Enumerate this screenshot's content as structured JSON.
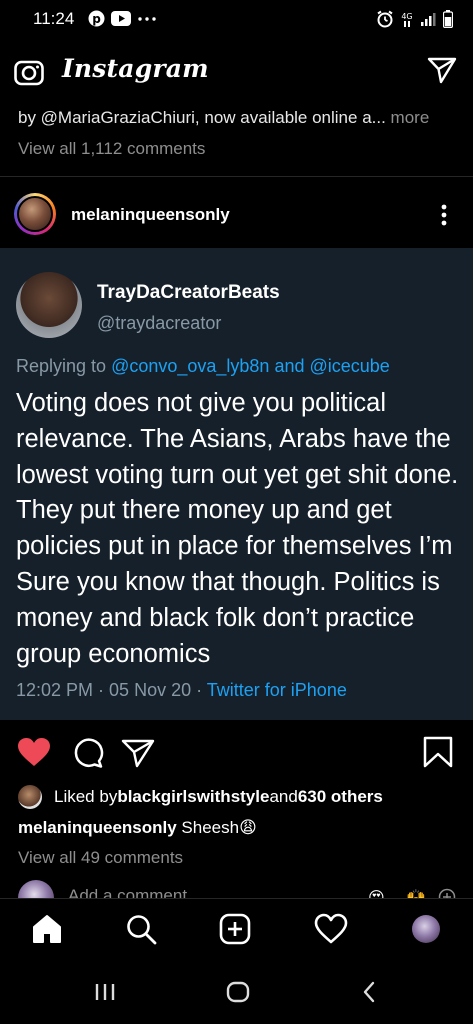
{
  "status_bar": {
    "time": "11:24",
    "left_icons": [
      "pinterest-icon",
      "youtube-icon",
      "more-dots-icon"
    ],
    "right_icons": [
      "alarm-icon",
      "data-icon",
      "signal-icon",
      "battery-icon"
    ]
  },
  "header": {
    "logo": "Instagram",
    "camera_icon": "camera-icon",
    "direct_icon": "direct-message-icon"
  },
  "prev_post": {
    "caption": "by @MariaGraziaChiuri, now available online a...",
    "more": " more",
    "view_comments": "View all 1,112 comments"
  },
  "post": {
    "username": "melaninqueensonly",
    "tweet": {
      "name": "TrayDaCreatorBeats",
      "handle": "@traydacreator",
      "reply_prefix": "Replying to ",
      "reply_to": "@convo_ova_lyb8n and @icecube",
      "text": "Voting does not give you political relevance. The Asians,  Arabs have the lowest voting turn out yet get shit done. They put there money up and get policies put in place for themselves I’m Sure you know that though. Politics is money and black folk don’t practice group economics",
      "timestamp": "12:02 PM · 05 Nov 20 · ",
      "source": "Twitter for iPhone"
    },
    "liked_by_prefix": "Liked by ",
    "liked_by_user": "blackgirlswithstyle",
    "liked_by_and": " and ",
    "liked_by_others": "630 others",
    "caption_user": "melaninqueensonly",
    "caption_text": " Sheesh😩",
    "view_comments": "View all 49 comments",
    "add_comment_placeholder": "Add a comment..."
  },
  "colors": {
    "background": "#000000",
    "tweet_bg": "#15202b",
    "twitter_blue": "#1da1f2",
    "muted": "#8e8e8e",
    "like_red": "#ed4956"
  },
  "bottom_nav": [
    "home-icon",
    "search-icon",
    "new-post-icon",
    "activity-icon",
    "profile-avatar"
  ]
}
